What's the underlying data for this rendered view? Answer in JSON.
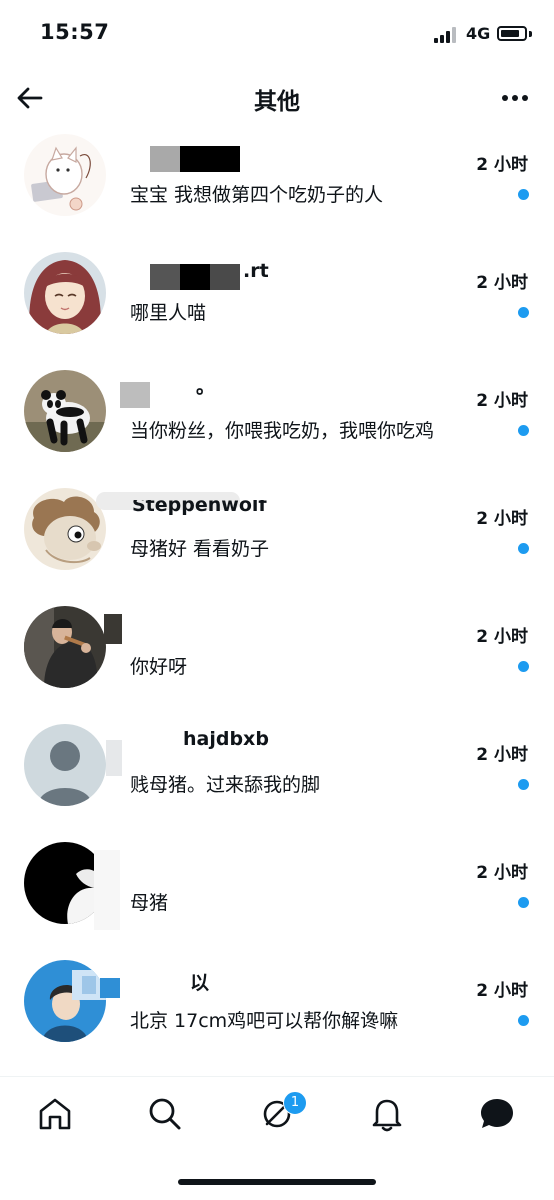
{
  "status_bar": {
    "time": "15:57",
    "network": "4G"
  },
  "header": {
    "title": "其他"
  },
  "messages": [
    {
      "name": "",
      "time": "2 小时",
      "text": "宝宝 我想做第四个吃奶子的人",
      "unread": true
    },
    {
      "name": ".rt",
      "time": "2 小时",
      "text": "哪里人喵",
      "unread": true
    },
    {
      "name": "。",
      "time": "2 小时",
      "text": "当你粉丝，你喂我吃奶，我喂你吃鸡",
      "unread": true
    },
    {
      "name": "Steppenwolf",
      "time": "2 小时",
      "text": "母猪好 看看奶子",
      "unread": true
    },
    {
      "name": "",
      "time": "2 小时",
      "text": "你好呀",
      "unread": true
    },
    {
      "name": "hajdbxb",
      "time": "2 小时",
      "text": "贱母猪。过来舔我的脚",
      "unread": true
    },
    {
      "name": "",
      "time": "2 小时",
      "text": "母猪",
      "unread": true
    },
    {
      "name": "以",
      "time": "2 小时",
      "text": "北京 17cm鸡吧可以帮你解谗嘛",
      "unread": true
    }
  ],
  "tabbar": {
    "messages_badge": "1"
  },
  "icons": {
    "back": "arrow-left-icon",
    "more": "more-horizontal-icon",
    "home": "home-icon",
    "search": "search-icon",
    "spaces": "spaces-icon",
    "notifications": "bell-icon",
    "messages": "message-bubble-icon"
  },
  "colors": {
    "accent": "#1d9bf0",
    "text": "#0f1419"
  }
}
